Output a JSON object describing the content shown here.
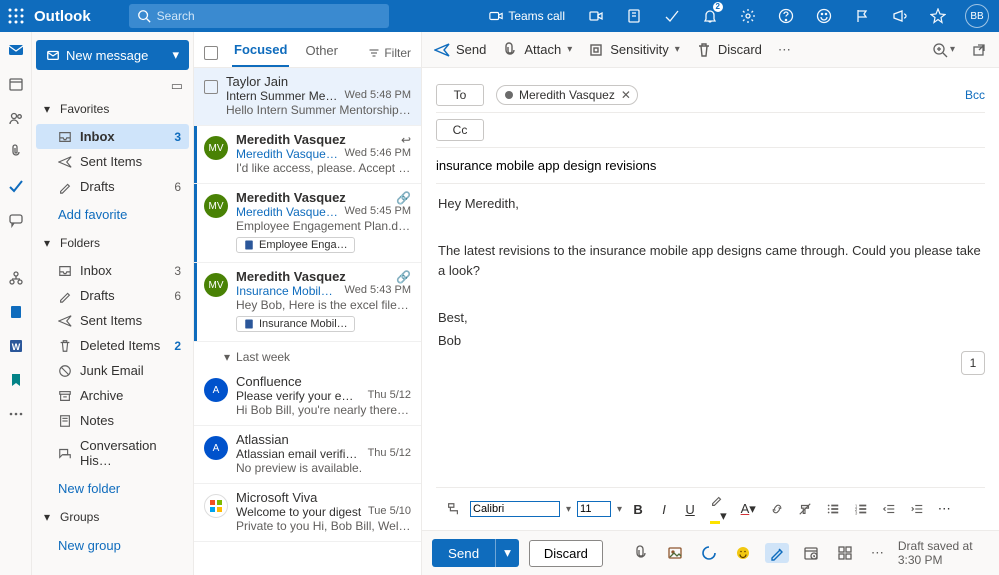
{
  "titlebar": {
    "app": "Outlook",
    "search_placeholder": "Search",
    "teams_call": "Teams call",
    "notif_badge": "2",
    "avatar": "BB"
  },
  "nav": {
    "new_message": "New message",
    "favorites": "Favorites",
    "fav_items": [
      {
        "icon": "inbox",
        "label": "Inbox",
        "count": "3",
        "selected": true
      },
      {
        "icon": "sent",
        "label": "Sent Items",
        "count": ""
      },
      {
        "icon": "drafts",
        "label": "Drafts",
        "count": "6"
      }
    ],
    "add_favorite": "Add favorite",
    "folders": "Folders",
    "folder_items": [
      {
        "icon": "inbox",
        "label": "Inbox",
        "count": "3"
      },
      {
        "icon": "drafts",
        "label": "Drafts",
        "count": "6"
      },
      {
        "icon": "sent",
        "label": "Sent Items",
        "count": ""
      },
      {
        "icon": "trash",
        "label": "Deleted Items",
        "count": "2",
        "blue": true
      },
      {
        "icon": "junk",
        "label": "Junk Email",
        "count": ""
      },
      {
        "icon": "archive",
        "label": "Archive",
        "count": ""
      },
      {
        "icon": "notes",
        "label": "Notes",
        "count": ""
      },
      {
        "icon": "conv",
        "label": "Conversation His…",
        "count": ""
      }
    ],
    "new_folder": "New folder",
    "groups": "Groups",
    "new_group": "New group"
  },
  "msglist": {
    "tab_focused": "Focused",
    "tab_other": "Other",
    "filter": "Filter",
    "group_lastweek": "Last week",
    "items": [
      {
        "kind": "msg",
        "sender": "Taylor Jain",
        "subj": "Intern Summer Men…",
        "time": "Wed 5:48 PM",
        "prev": "Hello Intern Summer Mentorship …",
        "avatar": "",
        "unread": false,
        "sel": true,
        "chk": true
      },
      {
        "kind": "msg",
        "sender": "Meredith Vasquez",
        "subj": "Meredith Vasquez …",
        "time": "Wed 5:46 PM",
        "prev": "I'd like access, please. Accept or D…",
        "avatar": "MV",
        "avcolor": "#498205",
        "unread": true,
        "meta": "reply"
      },
      {
        "kind": "msg",
        "sender": "Meredith Vasquez",
        "subj": "Meredith Vasquez …",
        "time": "Wed 5:45 PM",
        "prev": "Employee Engagement Plan.docx …",
        "avatar": "MV",
        "avcolor": "#498205",
        "unread": true,
        "meta": "link",
        "attach": "Employee Enga…"
      },
      {
        "kind": "msg",
        "sender": "Meredith Vasquez",
        "subj": "Insurance Mobile …",
        "time": "Wed 5:43 PM",
        "prev": "Hey Bob, Here is the excel file wit…",
        "avatar": "MV",
        "avcolor": "#498205",
        "unread": true,
        "meta": "link",
        "attach": "Insurance Mobil…"
      },
      {
        "kind": "group",
        "label": "Last week"
      },
      {
        "kind": "msg",
        "sender": "Confluence",
        "subj": "Please verify your email…",
        "time": "Thu 5/12",
        "prev": "Hi Bob Bill, you're nearly there! Cli…",
        "avatar": "A",
        "avcolor": "#0052cc",
        "unread": false
      },
      {
        "kind": "msg",
        "sender": "Atlassian",
        "subj": "Atlassian email verificat…",
        "time": "Thu 5/12",
        "prev": "No preview is available.",
        "avatar": "A",
        "avcolor": "#0052cc",
        "unread": false
      },
      {
        "kind": "msg",
        "sender": "Microsoft Viva",
        "subj": "Welcome to your digest",
        "time": "Tue 5/10",
        "prev": "Private to you Hi, Bob Bill, Welco…",
        "avatar": "MS",
        "avcolor": "#fff",
        "unread": false,
        "ms": true
      }
    ]
  },
  "cmd": {
    "send": "Send",
    "attach": "Attach",
    "sensitivity": "Sensitivity",
    "discard": "Discard"
  },
  "compose": {
    "to_label": "To",
    "cc_label": "Cc",
    "bcc_label": "Bcc",
    "to_chip": "Meredith Vasquez",
    "subject": "insurance mobile app design revisions",
    "body": {
      "l1": "Hey Meredith,",
      "l2": "The latest revisions to the insurance mobile app designs came through. Could you please take a look?",
      "l3": "Best,",
      "l4": "Bob"
    },
    "floating_count": "1"
  },
  "fmt": {
    "font": "Calibri",
    "size": "11"
  },
  "sendbar": {
    "send": "Send",
    "discard": "Discard",
    "draft": "Draft saved at 3:30 PM"
  }
}
